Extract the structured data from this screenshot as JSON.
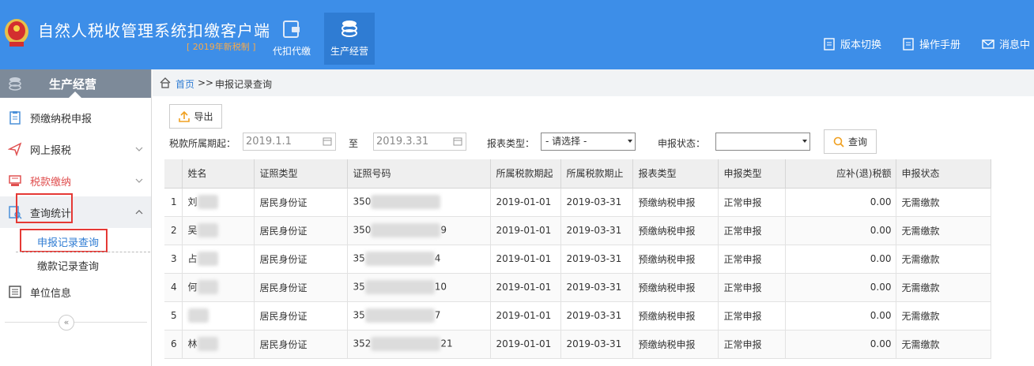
{
  "header": {
    "title": "自然人税收管理系统扣缴客户端",
    "subtitle": "[ 2019年新税制 ]",
    "nav": [
      {
        "label": "代扣代缴",
        "icon": "wallet-icon"
      },
      {
        "label": "生产经营",
        "icon": "coins-icon",
        "active": true
      }
    ],
    "links": {
      "version_switch": "版本切换",
      "manual": "操作手册",
      "message": "消息中"
    },
    "colors": {
      "bar": "#3d8ee8",
      "active_nav": "#2f7cd3",
      "subtitle": "#f7a94a"
    }
  },
  "sidebar": {
    "title": "生产经营",
    "items": [
      {
        "label": "预缴纳税申报",
        "icon": "clipboard-icon"
      },
      {
        "label": "网上报税",
        "icon": "send-icon"
      },
      {
        "label": "税款缴纳",
        "icon": "cash-register-icon"
      },
      {
        "label": "查询统计",
        "icon": "search-doc-icon"
      },
      {
        "label": "单位信息",
        "icon": "list-icon"
      }
    ],
    "sub_items": [
      {
        "label": "申报记录查询",
        "active": true
      },
      {
        "label": "缴款记录查询"
      }
    ],
    "collapse": "«"
  },
  "breadcrumb": {
    "home": "首页",
    "separator": ">>",
    "current": "申报记录查询"
  },
  "toolbar": {
    "export_label": "导出",
    "period_label": "税款所属期起：",
    "period_start": "2019.1.1",
    "to_label": "至",
    "period_end": "2019.3.31",
    "report_type_label": "报表类型：",
    "report_type_value": "- 请选择 -",
    "status_label": "申报状态：",
    "status_value": "",
    "query_label": "查询"
  },
  "table": {
    "headers": [
      "",
      "姓名",
      "证照类型",
      "证照号码",
      "所属税款期起",
      "所属税款期止",
      "报表类型",
      "申报类型",
      "应补(退)税额",
      "申报状态"
    ],
    "rows": [
      {
        "idx": "1",
        "name": "刘",
        "id_type": "居民身份证",
        "id_prefix": "350",
        "id_suffix": "",
        "start": "2019-01-01",
        "end": "2019-03-31",
        "report": "预缴纳税申报",
        "decl": "正常申报",
        "amount": "0.00",
        "status": "无需缴款"
      },
      {
        "idx": "2",
        "name": "吴",
        "id_type": "居民身份证",
        "id_prefix": "350",
        "id_suffix": "9",
        "start": "2019-01-01",
        "end": "2019-03-31",
        "report": "预缴纳税申报",
        "decl": "正常申报",
        "amount": "0.00",
        "status": "无需缴款"
      },
      {
        "idx": "3",
        "name": "占",
        "id_type": "居民身份证",
        "id_prefix": "35",
        "id_suffix": "4",
        "start": "2019-01-01",
        "end": "2019-03-31",
        "report": "预缴纳税申报",
        "decl": "正常申报",
        "amount": "0.00",
        "status": "无需缴款"
      },
      {
        "idx": "4",
        "name": "何",
        "id_type": "居民身份证",
        "id_prefix": "35",
        "id_suffix": "10",
        "start": "2019-01-01",
        "end": "2019-03-31",
        "report": "预缴纳税申报",
        "decl": "正常申报",
        "amount": "0.00",
        "status": "无需缴款"
      },
      {
        "idx": "5",
        "name": "",
        "id_type": "居民身份证",
        "id_prefix": "35",
        "id_suffix": "7",
        "start": "2019-01-01",
        "end": "2019-03-31",
        "report": "预缴纳税申报",
        "decl": "正常申报",
        "amount": "0.00",
        "status": "无需缴款"
      },
      {
        "idx": "6",
        "name": "林",
        "id_type": "居民身份证",
        "id_prefix": "352",
        "id_suffix": "21",
        "start": "2019-01-01",
        "end": "2019-03-31",
        "report": "预缴纳税申报",
        "decl": "正常申报",
        "amount": "0.00",
        "status": "无需缴款"
      }
    ]
  }
}
